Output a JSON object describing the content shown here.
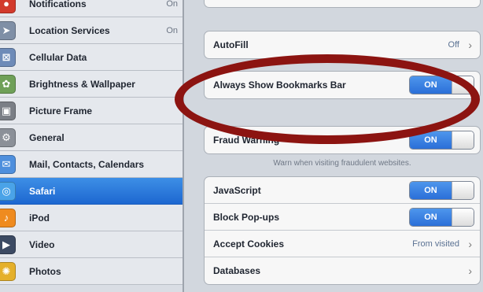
{
  "sidebar": {
    "items": [
      {
        "label": "Notifications",
        "value": "On",
        "icon": "notifications-icon",
        "icon_color": "#d23a2c",
        "glyph": "●"
      },
      {
        "label": "Location Services",
        "value": "On",
        "icon": "location-services-icon",
        "icon_color": "#7f8fa6",
        "glyph": "➤"
      },
      {
        "label": "Cellular Data",
        "value": "",
        "icon": "cellular-data-icon",
        "icon_color": "#6e8bb8",
        "glyph": "⊠"
      },
      {
        "label": "Brightness & Wallpaper",
        "value": "",
        "icon": "brightness-wallpaper-icon",
        "icon_color": "#6fa058",
        "glyph": "✿"
      },
      {
        "label": "Picture Frame",
        "value": "",
        "icon": "picture-frame-icon",
        "icon_color": "#7b7f86",
        "glyph": "▣"
      },
      {
        "label": "General",
        "value": "",
        "icon": "gear-icon",
        "icon_color": "#8b9098",
        "glyph": "⚙"
      },
      {
        "label": "Mail, Contacts, Calendars",
        "value": "",
        "icon": "mail-icon",
        "icon_color": "#4e8fdd",
        "glyph": "✉"
      },
      {
        "label": "Safari",
        "value": "",
        "icon": "safari-icon",
        "icon_color": "#4aa3e8",
        "glyph": "◎",
        "selected": true
      },
      {
        "label": "iPod",
        "value": "",
        "icon": "ipod-icon",
        "icon_color": "#ef8b1f",
        "glyph": "♪"
      },
      {
        "label": "Video",
        "value": "",
        "icon": "video-icon",
        "icon_color": "#3c4a63",
        "glyph": "▶"
      },
      {
        "label": "Photos",
        "value": "",
        "icon": "photos-icon",
        "icon_color": "#e5b02a",
        "glyph": "✺"
      }
    ]
  },
  "main": {
    "groups": {
      "autofill": {
        "label": "AutoFill",
        "value": "Off"
      },
      "bookmarks": {
        "label": "Always Show Bookmarks Bar",
        "toggle": "ON"
      },
      "fraud": {
        "label": "Fraud Warning",
        "toggle": "ON",
        "note": "Warn when visiting fraudulent websites."
      },
      "advanced": {
        "javascript": {
          "label": "JavaScript",
          "toggle": "ON"
        },
        "popups": {
          "label": "Block Pop-ups",
          "toggle": "ON"
        },
        "cookies": {
          "label": "Accept Cookies",
          "value": "From visited"
        },
        "databases": {
          "label": "Databases"
        }
      }
    }
  },
  "colors": {
    "highlight": "#8c1411",
    "accent": "#2b6fd8"
  }
}
